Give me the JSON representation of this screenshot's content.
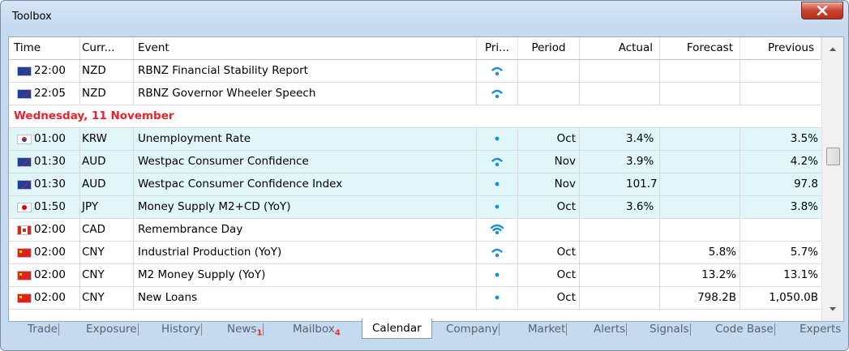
{
  "window": {
    "title": "Toolbox"
  },
  "columns": {
    "time": "Time",
    "currency": "Curr...",
    "event": "Event",
    "priority": "Pri...",
    "period": "Period",
    "actual": "Actual",
    "forecast": "Forecast",
    "previous": "Previous"
  },
  "rows": [
    {
      "flag": "nz-flag-icon",
      "time": "22:00",
      "currency": "NZD",
      "event": "RBNZ Financial Stability Report",
      "priority": "medium",
      "period": "",
      "actual": "",
      "forecast": "",
      "previous": ""
    },
    {
      "flag": "nz-flag-icon",
      "time": "22:05",
      "currency": "NZD",
      "event": "RBNZ Governor Wheeler Speech",
      "priority": "medium",
      "period": "",
      "actual": "",
      "forecast": "",
      "previous": ""
    }
  ],
  "date_separator": "Wednesday, 11 November",
  "rows2": [
    {
      "flag": "kr-flag-icon",
      "time": "01:00",
      "currency": "KRW",
      "event": "Unemployment Rate",
      "priority": "low",
      "period": "Oct",
      "actual": "3.4%",
      "forecast": "",
      "previous": "3.5%"
    },
    {
      "flag": "au-flag-icon",
      "time": "01:30",
      "currency": "AUD",
      "event": "Westpac Consumer Confidence",
      "priority": "medium",
      "period": "Nov",
      "actual": "3.9%",
      "forecast": "",
      "previous": "4.2%"
    },
    {
      "flag": "au-flag-icon",
      "time": "01:30",
      "currency": "AUD",
      "event": "Westpac Consumer Confidence Index",
      "priority": "low",
      "period": "Nov",
      "actual": "101.7",
      "forecast": "",
      "previous": "97.8"
    },
    {
      "flag": "jp-flag-icon",
      "time": "01:50",
      "currency": "JPY",
      "event": "Money Supply M2+CD (YoY)",
      "priority": "low",
      "period": "Oct",
      "actual": "3.6%",
      "forecast": "",
      "previous": "3.8%"
    },
    {
      "flag": "ca-flag-icon",
      "time": "02:00",
      "currency": "CAD",
      "event": "Remembrance Day",
      "priority": "high",
      "period": "",
      "actual": "",
      "forecast": "",
      "previous": ""
    },
    {
      "flag": "cn-flag-icon",
      "time": "02:00",
      "currency": "CNY",
      "event": "Industrial Production (YoY)",
      "priority": "medium",
      "period": "Oct",
      "actual": "",
      "forecast": "5.8%",
      "previous": "5.7%"
    },
    {
      "flag": "cn-flag-icon",
      "time": "02:00",
      "currency": "CNY",
      "event": "M2 Money Supply (YoY)",
      "priority": "low",
      "period": "Oct",
      "actual": "",
      "forecast": "13.2%",
      "previous": "13.1%"
    },
    {
      "flag": "cn-flag-icon",
      "time": "02:00",
      "currency": "CNY",
      "event": "New Loans",
      "priority": "low",
      "period": "Oct",
      "actual": "",
      "forecast": "798.2B",
      "previous": "1,050.0B"
    }
  ],
  "tabs": {
    "trade": "Trade",
    "exposure": "Exposure",
    "history": "History",
    "news": "News",
    "news_count": "1",
    "mailbox": "Mailbox",
    "mailbox_count": "4",
    "calendar": "Calendar",
    "company": "Company",
    "market": "Market",
    "alerts": "Alerts",
    "signals": "Signals",
    "codebase": "Code Base",
    "experts": "Experts"
  },
  "colors": {
    "highlight_row": "#e0f6fb",
    "date_text": "#e8242c",
    "priority_icon": "#1a8fd6"
  }
}
